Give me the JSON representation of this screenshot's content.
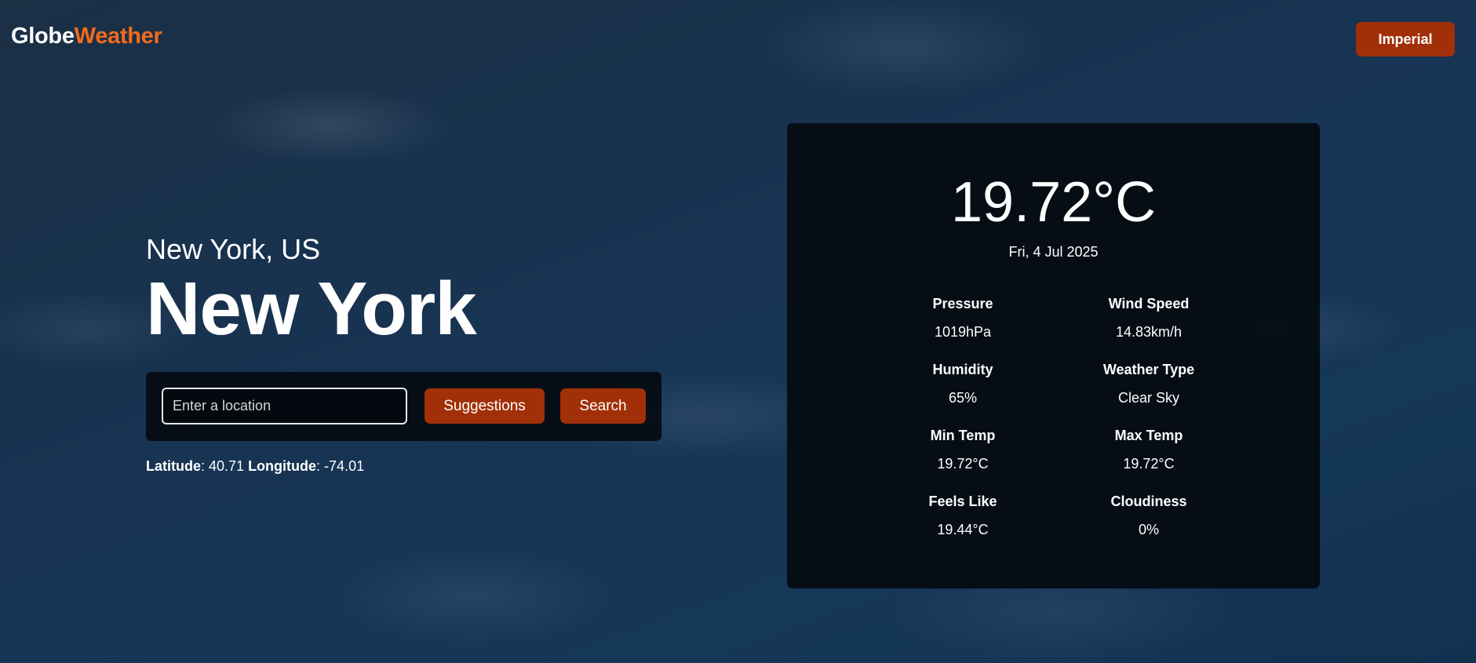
{
  "brand": {
    "part1": "Globe",
    "part2": "Weather",
    "accent_color": "#f26a1b"
  },
  "header": {
    "units_button": "Imperial"
  },
  "location": {
    "subtitle": "New York, US",
    "city": "New York"
  },
  "search": {
    "placeholder": "Enter a location",
    "value": "",
    "suggestions_label": "Suggestions",
    "search_label": "Search"
  },
  "coords": {
    "lat_label": "Latitude",
    "lat_value": ": 40.71",
    "lon_label": "Longitude",
    "lon_value": ": -74.01"
  },
  "weather": {
    "temperature": "19.72°C",
    "date": "Fri, 4 Jul 2025",
    "stats": [
      {
        "label": "Pressure",
        "value": "1019hPa"
      },
      {
        "label": "Wind Speed",
        "value": "14.83km/h"
      },
      {
        "label": "Humidity",
        "value": "65%"
      },
      {
        "label": "Weather Type",
        "value": "Clear Sky"
      },
      {
        "label": "Min Temp",
        "value": "19.72°C"
      },
      {
        "label": "Max Temp",
        "value": "19.72°C"
      },
      {
        "label": "Feels Like",
        "value": "19.44°C"
      },
      {
        "label": "Cloudiness",
        "value": "0%"
      }
    ]
  },
  "colors": {
    "button": "#a13008",
    "panel": "#04090e"
  }
}
